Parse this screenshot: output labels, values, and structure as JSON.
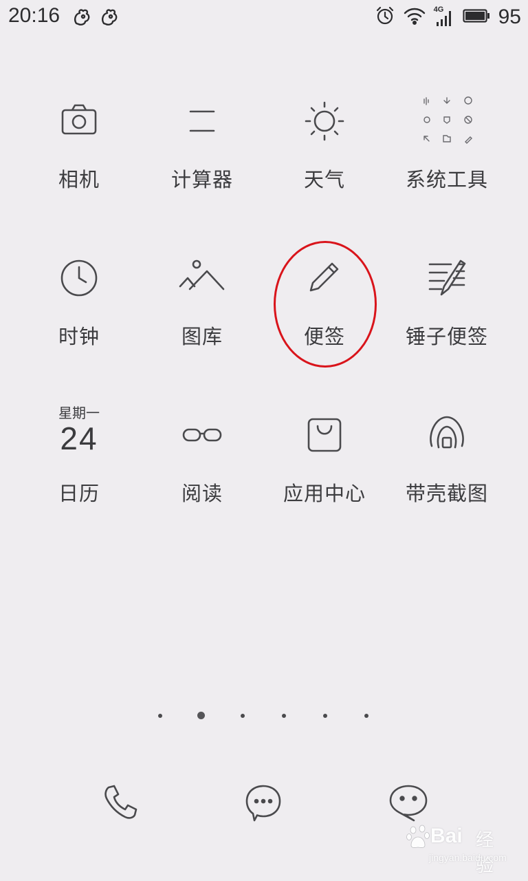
{
  "status_bar": {
    "time": "20:16",
    "network_type": "4G",
    "battery_level": "95",
    "left_icons": [
      "squirrel-notification-icon",
      "squirrel-notification-icon"
    ],
    "right_icons": [
      "alarm-icon",
      "wifi-icon",
      "cell-signal-icon",
      "battery-icon"
    ]
  },
  "apps": [
    {
      "label": "相机",
      "icon": "camera-icon"
    },
    {
      "label": "计算器",
      "icon": "calculator-icon"
    },
    {
      "label": "天气",
      "icon": "sun-icon"
    },
    {
      "label": "系统工具",
      "icon": "system-tools-folder-icon"
    },
    {
      "label": "时钟",
      "icon": "clock-icon"
    },
    {
      "label": "图库",
      "icon": "gallery-icon"
    },
    {
      "label": "便签",
      "icon": "pencil-icon"
    },
    {
      "label": "锤子便签",
      "icon": "hammer-notes-icon"
    },
    {
      "label": "日历",
      "icon": "calendar-icon",
      "weekday": "星期一",
      "day": "24"
    },
    {
      "label": "阅读",
      "icon": "glasses-icon"
    },
    {
      "label": "应用中心",
      "icon": "shopping-bag-icon"
    },
    {
      "label": "带壳截图",
      "icon": "shell-screenshot-icon"
    }
  ],
  "pager": {
    "pages": 6,
    "current": 2
  },
  "dock": [
    {
      "icon": "phone-icon"
    },
    {
      "icon": "message-icon"
    },
    {
      "icon": "chat-icon"
    }
  ],
  "watermark": {
    "brand": "Bai",
    "product": "经验",
    "url": "jingyan.baidu.com"
  },
  "colors": {
    "background": "#efedf0",
    "icon_stroke": "#4a4a4d",
    "highlight": "#d9141b"
  }
}
